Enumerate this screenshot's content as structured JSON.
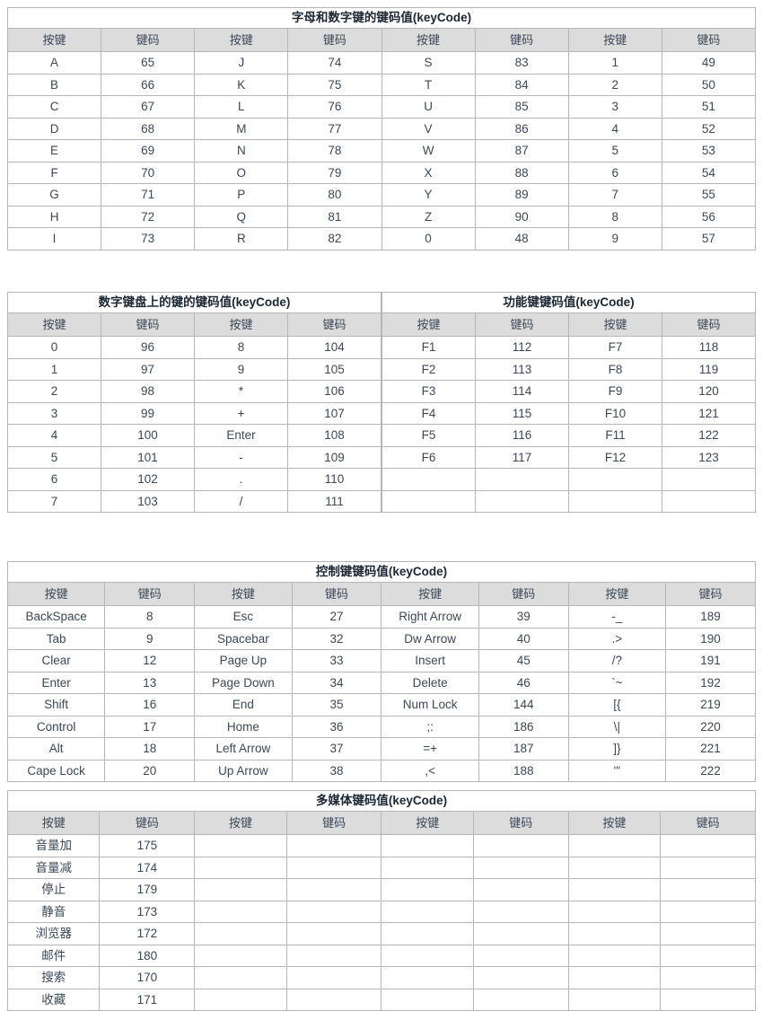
{
  "document": {
    "language": "zh-CN",
    "column_headers": {
      "key": "按键",
      "code": "键码"
    }
  },
  "tables": [
    {
      "id": "alnum",
      "title": "字母和数字键的键码值(keyCode)",
      "pairs_per_row": 4,
      "headers": [
        "按键",
        "键码",
        "按键",
        "键码",
        "按键",
        "键码",
        "按键",
        "键码"
      ],
      "rows": [
        [
          "A",
          "65",
          "J",
          "74",
          "S",
          "83",
          "1",
          "49"
        ],
        [
          "B",
          "66",
          "K",
          "75",
          "T",
          "84",
          "2",
          "50"
        ],
        [
          "C",
          "67",
          "L",
          "76",
          "U",
          "85",
          "3",
          "51"
        ],
        [
          "D",
          "68",
          "M",
          "77",
          "V",
          "86",
          "4",
          "52"
        ],
        [
          "E",
          "69",
          "N",
          "78",
          "W",
          "87",
          "5",
          "53"
        ],
        [
          "F",
          "70",
          "O",
          "79",
          "X",
          "88",
          "6",
          "54"
        ],
        [
          "G",
          "71",
          "P",
          "80",
          "Y",
          "89",
          "7",
          "55"
        ],
        [
          "H",
          "72",
          "Q",
          "81",
          "Z",
          "90",
          "8",
          "56"
        ],
        [
          "I",
          "73",
          "R",
          "82",
          "0",
          "48",
          "9",
          "57"
        ]
      ]
    },
    {
      "id": "numpad",
      "title": "数字键盘上的键的键码值(keyCode)",
      "pairs_per_row": 2,
      "headers": [
        "按键",
        "键码",
        "按键",
        "键码"
      ],
      "rows": [
        [
          "0",
          "96",
          "8",
          "104"
        ],
        [
          "1",
          "97",
          "9",
          "105"
        ],
        [
          "2",
          "98",
          "*",
          "106"
        ],
        [
          "3",
          "99",
          "+",
          "107"
        ],
        [
          "4",
          "100",
          "Enter",
          "108"
        ],
        [
          "5",
          "101",
          "-",
          "109"
        ],
        [
          "6",
          "102",
          ".",
          "110"
        ],
        [
          "7",
          "103",
          "/",
          "111"
        ]
      ]
    },
    {
      "id": "func",
      "title": "功能键键码值(keyCode)",
      "pairs_per_row": 2,
      "headers": [
        "按键",
        "键码",
        "按键",
        "键码"
      ],
      "rows": [
        [
          "F1",
          "112",
          "F7",
          "118"
        ],
        [
          "F2",
          "113",
          "F8",
          "119"
        ],
        [
          "F3",
          "114",
          "F9",
          "120"
        ],
        [
          "F4",
          "115",
          "F10",
          "121"
        ],
        [
          "F5",
          "116",
          "F11",
          "122"
        ],
        [
          "F6",
          "117",
          "F12",
          "123"
        ],
        [
          "",
          "",
          "",
          ""
        ],
        [
          "",
          "",
          "",
          ""
        ]
      ]
    },
    {
      "id": "ctrl",
      "title": "控制键键码值(keyCode)",
      "pairs_per_row": 4,
      "headers": [
        "按键",
        "键码",
        "按键",
        "键码",
        "按键",
        "键码",
        "按键",
        "键码"
      ],
      "rows": [
        [
          "BackSpace",
          "8",
          "Esc",
          "27",
          "Right Arrow",
          "39",
          "-_",
          "189"
        ],
        [
          "Tab",
          "9",
          "Spacebar",
          "32",
          "Dw Arrow",
          "40",
          ".>",
          "190"
        ],
        [
          "Clear",
          "12",
          "Page Up",
          "33",
          "Insert",
          "45",
          "/?",
          "191"
        ],
        [
          "Enter",
          "13",
          "Page Down",
          "34",
          "Delete",
          "46",
          "`~",
          "192"
        ],
        [
          "Shift",
          "16",
          "End",
          "35",
          "Num Lock",
          "144",
          "[{",
          "219"
        ],
        [
          "Control",
          "17",
          "Home",
          "36",
          ";:",
          "186",
          "\\|",
          "220"
        ],
        [
          "Alt",
          "18",
          "Left Arrow",
          "37",
          "=+",
          "187",
          "]}",
          "221"
        ],
        [
          "Cape Lock",
          "20",
          "Up Arrow",
          "38",
          ",<",
          "188",
          "'\"",
          "222"
        ]
      ]
    },
    {
      "id": "media",
      "title": "多媒体键码值(keyCode)",
      "pairs_per_row": 4,
      "headers": [
        "按键",
        "键码",
        "按键",
        "键码",
        "按键",
        "键码",
        "按键",
        "键码"
      ],
      "rows": [
        [
          "音量加",
          "175",
          "",
          "",
          "",
          "",
          "",
          ""
        ],
        [
          "音量减",
          "174",
          "",
          "",
          "",
          "",
          "",
          ""
        ],
        [
          "停止",
          "179",
          "",
          "",
          "",
          "",
          "",
          ""
        ],
        [
          "静音",
          "173",
          "",
          "",
          "",
          "",
          "",
          ""
        ],
        [
          "浏览器",
          "172",
          "",
          "",
          "",
          "",
          "",
          ""
        ],
        [
          "邮件",
          "180",
          "",
          "",
          "",
          "",
          "",
          ""
        ],
        [
          "搜索",
          "170",
          "",
          "",
          "",
          "",
          "",
          ""
        ],
        [
          "收藏",
          "171",
          "",
          "",
          "",
          "",
          "",
          ""
        ]
      ]
    }
  ],
  "colors": {
    "header_background": "#dcdcdc",
    "border": "#b6b6b6",
    "text": "#3c4858",
    "title_text": "#1b2733",
    "page_background": "#ffffff"
  }
}
